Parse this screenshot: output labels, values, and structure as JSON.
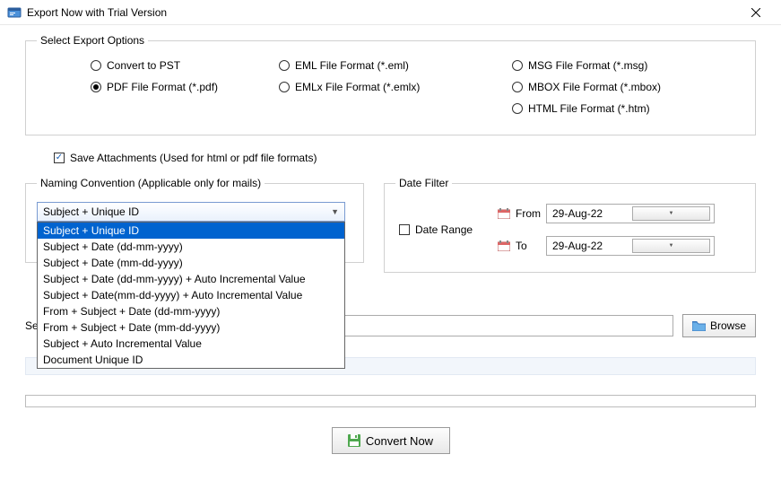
{
  "window": {
    "title": "Export Now with Trial Version"
  },
  "fieldsets": {
    "export_options": "Select Export Options",
    "naming": "Naming Convention (Applicable only for mails)",
    "date_filter": "Date Filter"
  },
  "radios": {
    "convert_pst": "Convert to PST",
    "pdf": "PDF File Format (*.pdf)",
    "eml": "EML File  Format (*.eml)",
    "emlx": "EMLx File  Format (*.emlx)",
    "msg": "MSG File Format (*.msg)",
    "mbox": "MBOX File Format (*.mbox)",
    "html": "HTML File  Format (*.htm)"
  },
  "checks": {
    "save_attachments": "Save Attachments (Used for html or pdf file formats)",
    "date_range": "Date Range"
  },
  "naming_combo": {
    "selected": "Subject + Unique ID",
    "options": [
      "Subject + Unique ID",
      "Subject + Date (dd-mm-yyyy)",
      "Subject + Date (mm-dd-yyyy)",
      "Subject + Date (dd-mm-yyyy) + Auto Incremental Value",
      "Subject + Date(mm-dd-yyyy) + Auto Incremental Value",
      "From + Subject + Date (dd-mm-yyyy)",
      "From + Subject + Date (mm-dd-yyyy)",
      "Subject + Auto Incremental Value",
      "Document Unique ID"
    ]
  },
  "date": {
    "from_label": "From",
    "to_label": "To",
    "from_value": "29-Aug-22",
    "to_value": "29-Aug-22"
  },
  "dest": {
    "label": "Sele"
  },
  "buttons": {
    "browse": "Browse",
    "convert": "Convert Now"
  }
}
